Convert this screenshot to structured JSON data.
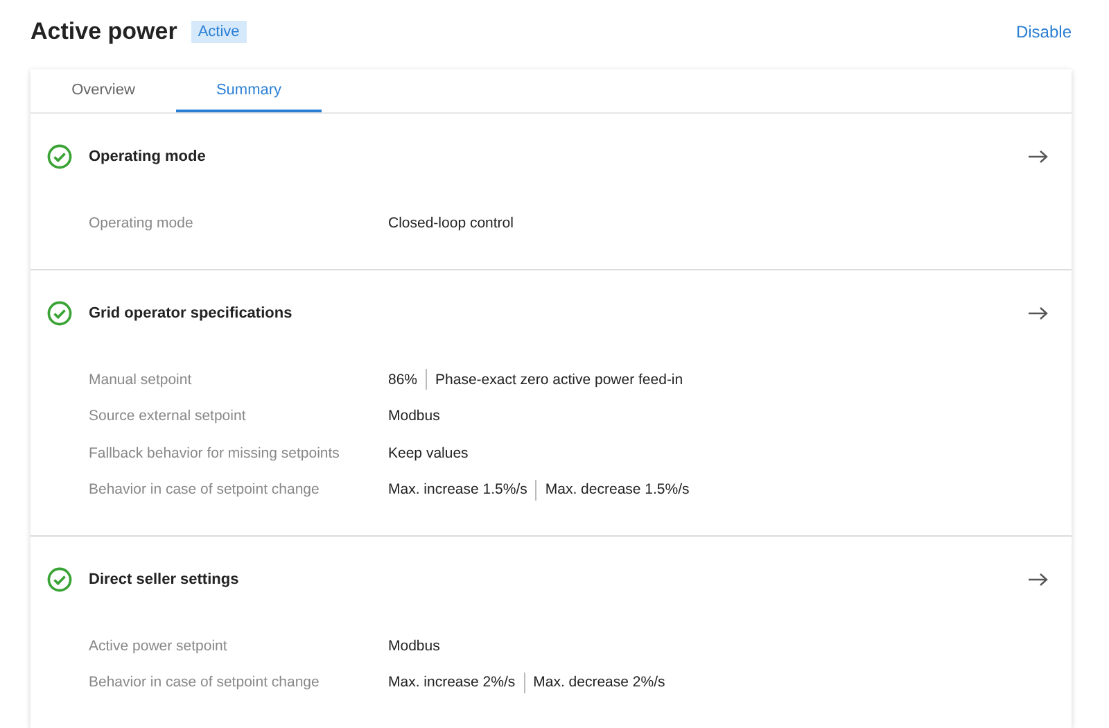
{
  "header": {
    "title": "Active power",
    "badge": "Active",
    "action": "Disable"
  },
  "tabs": [
    {
      "label": "Overview",
      "selected": false
    },
    {
      "label": "Summary",
      "selected": true
    }
  ],
  "sections": [
    {
      "title": "Operating mode",
      "complete": true,
      "rows": [
        {
          "label": "Operating mode",
          "value": [
            "Closed-loop control"
          ]
        }
      ]
    },
    {
      "title": "Grid operator specifications",
      "complete": true,
      "rows": [
        {
          "label": "Manual setpoint",
          "value": [
            "86%",
            "Phase-exact zero active power feed-in"
          ]
        },
        {
          "label": "Source external setpoint",
          "value": [
            "Modbus"
          ]
        },
        {
          "label": "Fallback behavior for missing setpoints",
          "value": [
            "Keep values"
          ]
        },
        {
          "label": "Behavior in case of setpoint change",
          "value": [
            "Max. increase 1.5%/s",
            "Max. decrease 1.5%/s"
          ]
        }
      ]
    },
    {
      "title": "Direct seller settings",
      "complete": true,
      "rows": [
        {
          "label": "Active power setpoint",
          "value": [
            "Modbus"
          ]
        },
        {
          "label": "Behavior in case of setpoint change",
          "value": [
            "Max. increase 2%/s",
            "Max. decrease 2%/s"
          ]
        }
      ]
    }
  ]
}
